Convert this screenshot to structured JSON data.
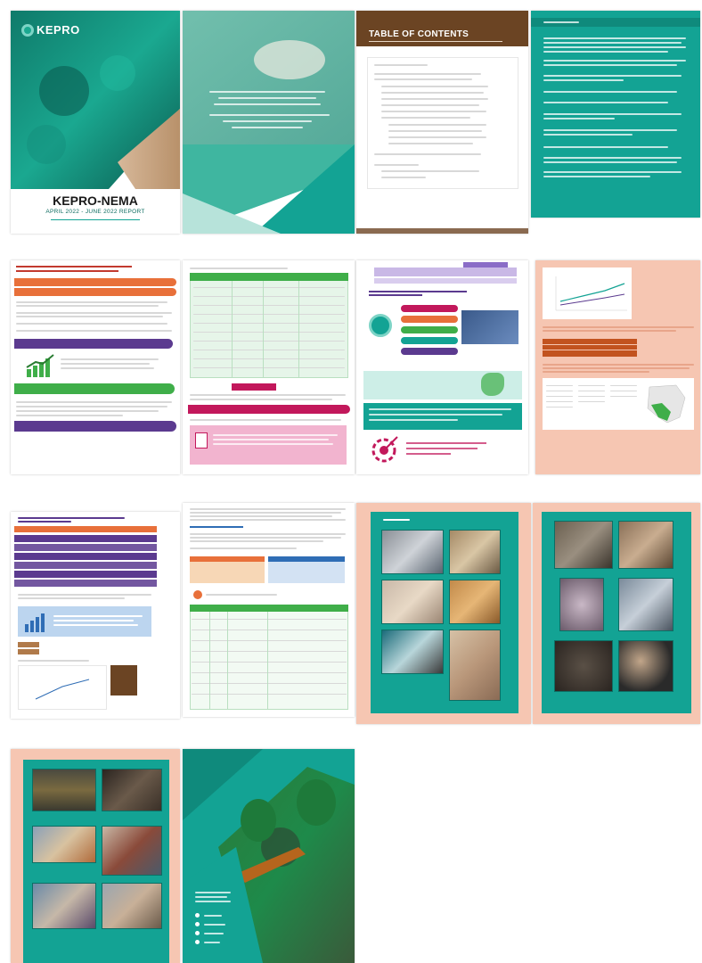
{
  "colors": {
    "teal": "#13a394",
    "dark_teal": "#0b6b5f",
    "brown": "#6b4423",
    "salmon": "#f6c6b2",
    "orange": "#e8703a",
    "green": "#3fae49",
    "purple": "#5b3a8f",
    "magenta": "#c2185b"
  },
  "cover": {
    "logo_text": "KEPRO",
    "title": "KEPRO-NEMA",
    "subtitle": "APRIL 2022 - JUNE 2022 REPORT"
  },
  "toc": {
    "heading": "TABLE OF CONTENTS"
  },
  "pages": {
    "intro": {
      "name": "introduction-page"
    },
    "table": {
      "name": "table-page"
    },
    "infographic": {
      "name": "infographic-page"
    },
    "chart": {
      "name": "chart-map-page"
    },
    "summary": {
      "name": "summary-page"
    },
    "data_table": {
      "name": "data-table-page"
    },
    "photos1": {
      "name": "photo-gallery-1"
    },
    "photos2": {
      "name": "photo-gallery-2"
    },
    "photos3": {
      "name": "photo-gallery-3"
    },
    "back_cover": {
      "name": "back-cover"
    }
  }
}
